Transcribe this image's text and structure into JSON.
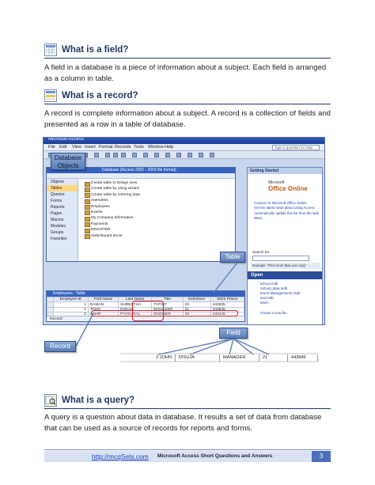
{
  "sections": {
    "field": {
      "heading": "What is a field?",
      "body": "A field in a database is a piece of information about a subject. Each field is arranged as a column in table."
    },
    "record": {
      "heading": "What is a record?",
      "body": "A record is complete information about a subject. A record is a collection of fields and presented as a row in a table of database."
    },
    "query": {
      "heading": "What is a query?",
      "body": "A query is a question about data in database. It results a set of data from database that can be used as a source of records for reports and forms."
    }
  },
  "screenshot": {
    "app_title": "Microsoft Access",
    "menu": [
      "File",
      "Edit",
      "View",
      "Insert",
      "Format",
      "Records",
      "Tools",
      "Window",
      "Help"
    ],
    "help_placeholder": "Type a question for help",
    "db_window_title": "Database (Access 2002 - 2003 file format)",
    "objects_header": "Objects",
    "objects": [
      "Tables",
      "Queries",
      "Forms",
      "Reports",
      "Pages",
      "Macros",
      "Modules"
    ],
    "groups_header": "Groups",
    "favorites": "Favorites",
    "object_items": [
      "Create table in Design view",
      "Create table by using wizard",
      "Create table by entering data",
      "Attendees",
      "Employees",
      "Events",
      "My Company Information",
      "Payments",
      "REGISTER",
      "Switchboard Items"
    ],
    "getting_started": {
      "title": "Getting Started",
      "microsoft": "Microsoft",
      "office_online": "Office Online",
      "links": [
        "Connect to Microsoft Office Online",
        "Get the latest news about using Access",
        "Automatically update this list from the web",
        "More..."
      ],
      "search_label": "Search for:",
      "example": "Example: \"Print more than one copy\"",
      "open_label": "Open",
      "files": [
        "school.mdb",
        "School_data.mdb",
        "Event Management1.mdb",
        "test.mdb",
        "More..."
      ],
      "create_new": "Create a new file..."
    },
    "table_window_title": "Employees : Table",
    "columns": [
      "Employee ID",
      "First Name",
      "Last Name",
      "Title",
      "Extension",
      "Work Phone"
    ],
    "rows": [
      [
        "1",
        "RAMAN",
        "SHRESTHA",
        "TYPIST",
        "23",
        "443835"
      ],
      [
        "2",
        "JOHN",
        "DISUJA",
        "MANAGER",
        "21",
        "443846"
      ],
      [
        "3",
        "AMAR",
        "PYAKURAL",
        "ENGINER",
        "19",
        "443445"
      ]
    ],
    "record_nav": "Record:"
  },
  "callouts": {
    "database_objects": "Database Objects",
    "table": "Table",
    "field": "Field",
    "record": "Record"
  },
  "field_strip": [
    "2 JOHN",
    "DISUJA",
    "MANAGER",
    "21",
    "443846"
  ],
  "footer": {
    "link": "http://mcqSets.com",
    "title": "Microsoft Access Short Questions and Answers",
    "page": "3"
  },
  "colors": {
    "heading": "#1f3763",
    "highlight": "#d4202a",
    "callout": "#5b7db7"
  }
}
